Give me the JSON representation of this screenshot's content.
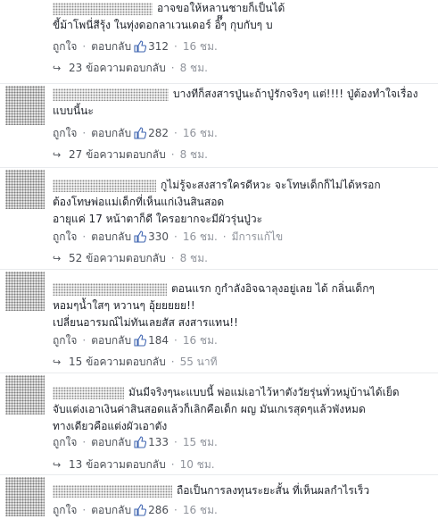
{
  "labels": {
    "like": "ถูกใจ",
    "reply": "ตอบกลับ",
    "separator": "·"
  },
  "comments": [
    {
      "text": "อาจขอให้หลานชายก็เป็นได้\nขี้ม้าโพนี่สีรุ้ง ในทุ่งดอกลาเวนเดอร์ อิ๊๊ๆ กุบกับๆ บ",
      "likes": "312",
      "time": "16 ชม.",
      "edited": "",
      "replies": "23 ข้อความตอบกลับ",
      "replies_time": "8 ชม."
    },
    {
      "text": "บางทีก็สงสารปู่นะถ้าปู่รักจริงๆ แต่!!!! ปู่ต้องทำใจเรื่อง\nแบบนี้นะ",
      "likes": "282",
      "time": "16 ชม.",
      "edited": "",
      "replies": "27 ข้อความตอบกลับ",
      "replies_time": "8 ชม."
    },
    {
      "text": "กูไม่รู้จะสงสารใครดีหวะ จะโทษเด็กก็ไม่ได้หรอก\nต้องโทษพ่อแม่เด็กที่เห็นแก่เงินสินสอด\nอายุแค่ 17 หน้าตาก็ดี ใครอยากจะมีผัวรุ่นปู่วะ",
      "likes": "330",
      "time": "16 ชม.",
      "edited": "มีการแก้ไข",
      "replies": "52 ข้อความตอบกลับ",
      "replies_time": "8 ชม."
    },
    {
      "text": "ตอนแรก กูกำลังอิจฉาลุงอยู่เลย ได้ กลิ่นเด็กๆ\nหอมๆน้ำใสๆ หวานๆ อุ้ยยยยย!!\nเปลี่ยนอารมณ์ไม่ทันเลยสัส สงสารแทน!!",
      "likes": "184",
      "time": "16 ชม.",
      "edited": "",
      "replies": "15 ข้อความตอบกลับ",
      "replies_time": "55 นาที"
    },
    {
      "text": "มันมีจริงๆนะแบบนี้ พ่อแม่เอาไว้หาตังวัยรุ่นทั่วหมู่บ้านได้เย็ด\nจับแต่งเอาเงินค่าสินสอดแล้วก็เลิกคือเด็ก ผญ มันเกเรสุดๆแล้วพังหมด\nทางเดียวคือแต่งผัวเอาตัง",
      "likes": "133",
      "time": "15 ชม.",
      "edited": "",
      "replies": "13 ข้อความตอบกลับ",
      "replies_time": "10 ชม."
    },
    {
      "text": "ถือเป็นการลงทุนระยะสั้น ที่เห็นผลกำไรเร็ว",
      "likes": "286",
      "time": "16 ชม.",
      "edited": "",
      "replies": "",
      "replies_time": ""
    }
  ]
}
